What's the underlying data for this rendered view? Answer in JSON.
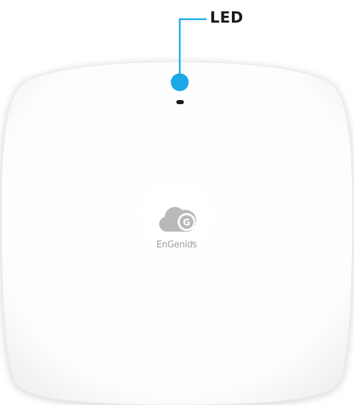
{
  "callout": {
    "label": "LED",
    "color": "#1da9e8"
  },
  "device": {
    "brand_name": "EnGenius",
    "logo_letter": "G",
    "body_color": "#ffffff",
    "logo_color": "#b9b9b9"
  }
}
